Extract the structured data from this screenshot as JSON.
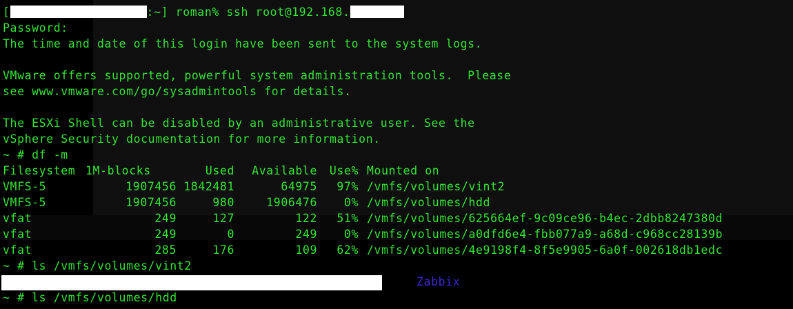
{
  "terminal": {
    "prompt_user": "roman",
    "prompt_suffix": ":~] roman% ",
    "ssh_command": "ssh root@192.168.",
    "password_prompt": "Password:",
    "login_notice": "The time and date of this login have been sent to the system logs.",
    "vmware_line1": "VMware offers supported, powerful system administration tools.  Please",
    "vmware_line2": "see www.vmware.com/go/sysadmintools for details.",
    "esxi_line1": "The ESXi Shell can be disabled by an administrative user. See the",
    "esxi_line2": "vSphere Security documentation for more information.",
    "cmd_df": "~ # df -m",
    "cmd_ls_vint2": "~ # ls /vmfs/volumes/vint2",
    "ls_item": "Zabbix",
    "cmd_ls_hdd": "~ # ls /vmfs/volumes/hdd"
  },
  "df_table": {
    "headers": {
      "filesystem": "Filesystem",
      "blocks": "1M-blocks",
      "used": "Used",
      "available": "Available",
      "use_pct": "Use%",
      "mounted": "Mounted on"
    },
    "rows": [
      {
        "filesystem": "VMFS-5",
        "blocks": "1907456",
        "used": "1842481",
        "available": "64975",
        "use_pct": "97%",
        "mounted": "/vmfs/volumes/vint2"
      },
      {
        "filesystem": "VMFS-5",
        "blocks": "1907456",
        "used": "980",
        "available": "1906476",
        "use_pct": "0%",
        "mounted": "/vmfs/volumes/hdd"
      },
      {
        "filesystem": "vfat",
        "blocks": "249",
        "used": "127",
        "available": "122",
        "use_pct": "51%",
        "mounted": "/vmfs/volumes/625664ef-9c09ce96-b4ec-2dbb8247380d"
      },
      {
        "filesystem": "vfat",
        "blocks": "249",
        "used": "0",
        "available": "249",
        "use_pct": "0%",
        "mounted": "/vmfs/volumes/a0dfd6e4-fbb077a9-a68d-c968cc28139b"
      },
      {
        "filesystem": "vfat",
        "blocks": "285",
        "used": "176",
        "available": "109",
        "use_pct": "62%",
        "mounted": "/vmfs/volumes/4e9198f4-8f5e9905-6a0f-002618db1edc"
      }
    ]
  },
  "colors": {
    "text": "#33e633",
    "background": "#000000",
    "listing_item": "#3a2bd6",
    "redaction": "#ffffff"
  }
}
